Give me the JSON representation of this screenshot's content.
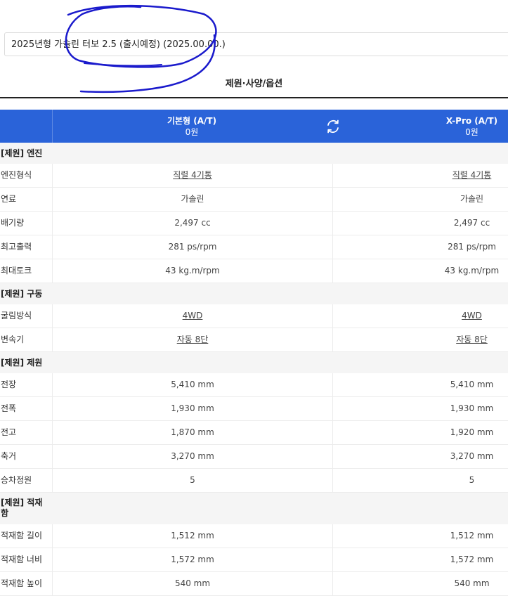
{
  "trim_select": {
    "value": "2025년형 가솔린 터보 2.5 (출시예정) (2025.00.00.)"
  },
  "section_title": "제원·사양/옵션",
  "header": {
    "trim1": {
      "name": "기본형 (A/T)",
      "price": "0원"
    },
    "trim2": {
      "name": "X-Pro (A/T)",
      "price": "0원"
    }
  },
  "categories": {
    "engine": "[제원] 엔진",
    "drive": "[제원] 구동",
    "dimension": "[제원] 제원",
    "cargo": "[제원] 적재함"
  },
  "rows": {
    "engine_type": {
      "label": "엔진형식",
      "v1": "직렬 4기통",
      "v2": "직렬 4기통"
    },
    "fuel": {
      "label": "연료",
      "v1": "가솔린",
      "v2": "가솔린"
    },
    "displacement": {
      "label": "배기량",
      "v1": "2,497 cc",
      "v2": "2,497 cc"
    },
    "max_power": {
      "label": "최고출력",
      "v1": "281 ps/rpm",
      "v2": "281 ps/rpm"
    },
    "max_torque": {
      "label": "최대토크",
      "v1": "43 kg.m/rpm",
      "v2": "43 kg.m/rpm"
    },
    "drive_type": {
      "label": "굴림방식",
      "v1": "4WD",
      "v2": "4WD"
    },
    "transmission": {
      "label": "변속기",
      "v1": "자동 8단",
      "v2": "자동 8단"
    },
    "length": {
      "label": "전장",
      "v1": "5,410 mm",
      "v2": "5,410 mm"
    },
    "width": {
      "label": "전폭",
      "v1": "1,930 mm",
      "v2": "1,930 mm"
    },
    "height": {
      "label": "전고",
      "v1": "1,870 mm",
      "v2": "1,920 mm"
    },
    "wheelbase": {
      "label": "축거",
      "v1": "3,270 mm",
      "v2": "3,270 mm"
    },
    "seating": {
      "label": "승차정원",
      "v1": "5",
      "v2": "5"
    },
    "cargo_length": {
      "label": "적재함 길이",
      "v1": "1,512 mm",
      "v2": "1,512 mm"
    },
    "cargo_width": {
      "label": "적재함 너비",
      "v1": "1,572 mm",
      "v2": "1,572 mm"
    },
    "cargo_height": {
      "label": "적재함 높이",
      "v1": "540 mm",
      "v2": "540 mm"
    }
  },
  "colors": {
    "header_bg": "#2a63d9",
    "highlight": "#2a63d9",
    "annotation": "#1a1acc"
  },
  "icons": {
    "swap": "swap-icon"
  }
}
